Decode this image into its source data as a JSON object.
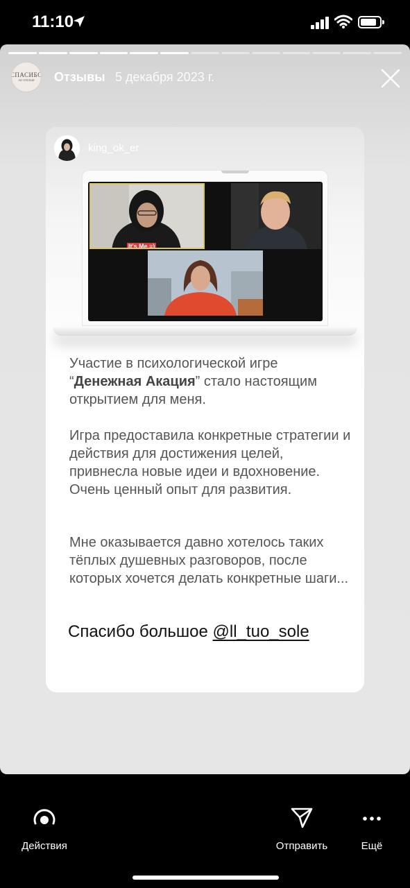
{
  "status_bar": {
    "time": "11:10",
    "icons": [
      "location-arrow-icon",
      "cellular-signal-icon",
      "wifi-icon",
      "battery-icon"
    ]
  },
  "story": {
    "progress": {
      "total_segments": 13,
      "completed_segments": 6
    },
    "account": {
      "avatar_text": "СПАСИБО",
      "avatar_subtext": "за отзыв",
      "name": "Отзывы"
    },
    "date": "5 декабря 2023 г.",
    "close_icon": "close-icon"
  },
  "review_card": {
    "username": "king_ok_er",
    "screenshot_caption": "It's Me =)",
    "paragraph1_part1": "Участие в психологической игре “",
    "paragraph1_bold": "Денежная Акация",
    "paragraph1_part2": "” стало настоящим открытием для меня.",
    "paragraph2": "Игра предоставила конкретные стратегии и действия для достижения  целей, привнесла новые идеи и вдохновение. Очень ценный опыт для развития.",
    "paragraph3": "Мне оказывается давно хотелось таких тёплых душевных разговоров, после которых хочется делать конкретные шаги...",
    "thanks_text": "Спасибо большое ",
    "thanks_mention": "@ll_tuo_sole"
  },
  "bottom_bar": {
    "actions_label": "Действия",
    "send_label": "Отправить",
    "more_label": "Ещё"
  },
  "colors": {
    "background": "#000000",
    "story_bg": "#e4e4e4",
    "card_text": "#555555",
    "caption_red": "#d93a3a"
  }
}
